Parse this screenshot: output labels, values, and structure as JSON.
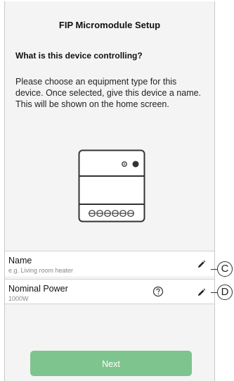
{
  "page": {
    "title": "FIP Micromodule Setup",
    "question": "What is this device controlling?",
    "instructions": "Please choose an equipment type for this device. Once selected, give this device a name. This will be shown on the home screen."
  },
  "fields": {
    "name": {
      "label": "Name",
      "placeholder": "e.g. Living room heater"
    },
    "nominal_power": {
      "label": "Nominal Power",
      "value": "1000W"
    }
  },
  "actions": {
    "next_label": "Next"
  },
  "callouts": {
    "name": "C",
    "power": "D"
  },
  "colors": {
    "next_button": "#7ec48f",
    "background": "#f4f4f4"
  }
}
